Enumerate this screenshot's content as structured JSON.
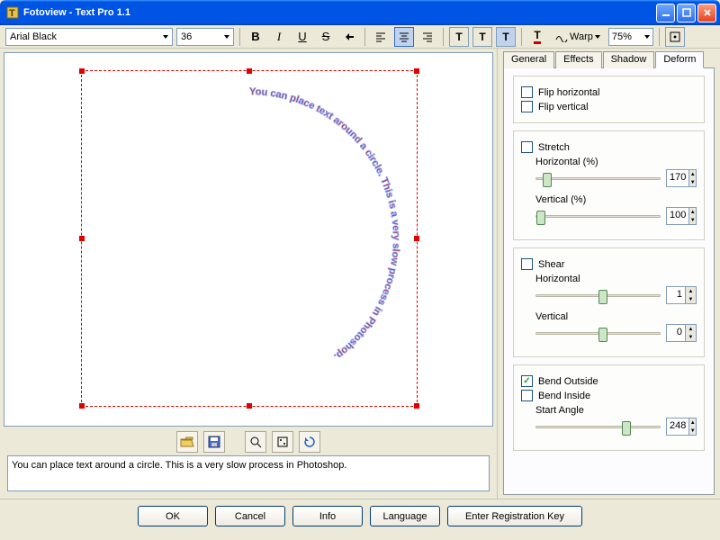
{
  "window": {
    "title": "Fotoview - Text Pro 1.1"
  },
  "toolbar": {
    "font": "Arial Black",
    "size": "36",
    "warp_label": "Warp",
    "zoom": "75%"
  },
  "text_content": "You can place text around a circle. This is a very slow process in Photoshop.",
  "circle_text": "You can place text around a circle.  This is a very slow process in Photoshop.  ",
  "tabs": {
    "general": "General",
    "effects": "Effects",
    "shadow": "Shadow",
    "deform": "Deform"
  },
  "panel": {
    "flip_h": "Flip horizontal",
    "flip_v": "Flip vertical",
    "stretch": "Stretch",
    "horiz_pct": "Horizontal (%)",
    "vert_pct": "Vertical (%)",
    "stretch_h": "170",
    "stretch_v": "100",
    "shear": "Shear",
    "shear_h_label": "Horizontal",
    "shear_v_label": "Vertical",
    "shear_h": "1",
    "shear_v": "0",
    "bend_out": "Bend Outside",
    "bend_in": "Bend Inside",
    "start_angle_label": "Start Angle",
    "start_angle": "248"
  },
  "buttons": {
    "ok": "OK",
    "cancel": "Cancel",
    "info": "Info",
    "language": "Language",
    "register": "Enter Registration Key"
  }
}
